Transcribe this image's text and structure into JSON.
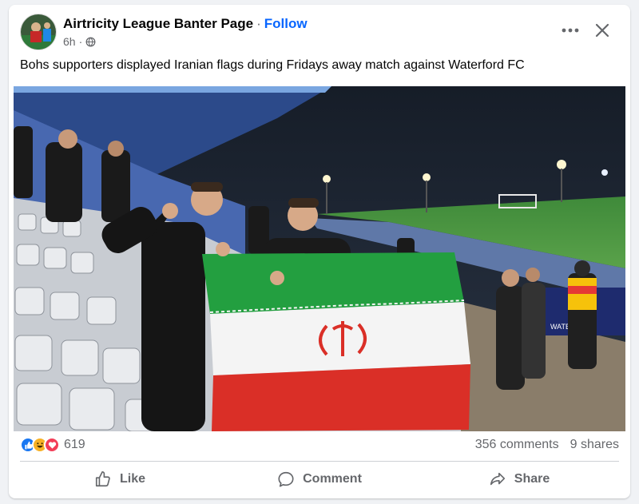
{
  "post": {
    "page_name": "Airtricity League Banter Page",
    "separator": "·",
    "follow_label": "Follow",
    "time": "6h",
    "time_separator": "·",
    "privacy_icon": "globe-icon",
    "caption": "Bohs supporters displayed Iranian flags during Fridays away match against Waterford FC"
  },
  "image": {
    "description_icon": "photo",
    "stand_sign_text": "WATERFORD"
  },
  "reactions": {
    "icons": [
      "like-icon",
      "haha-icon",
      "love-icon"
    ],
    "count": "619"
  },
  "stats": {
    "comments": "356 comments",
    "shares": "9 shares"
  },
  "actions": {
    "like": "Like",
    "comment": "Comment",
    "share": "Share"
  },
  "colors": {
    "accent": "#0866ff",
    "secondary_text": "#65676b",
    "like_blue": "#1877f2",
    "love_red": "#f33e58",
    "haha_yellow": "#f7b125"
  }
}
